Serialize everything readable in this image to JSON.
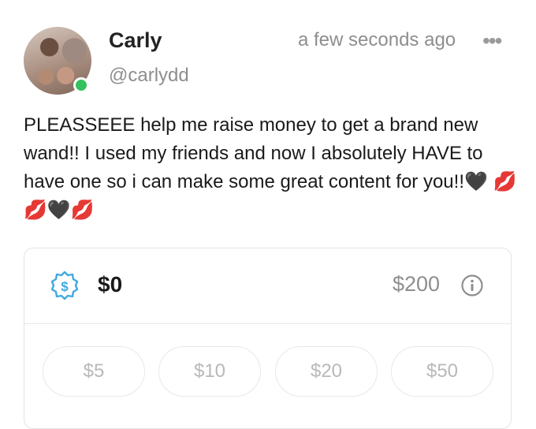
{
  "post": {
    "display_name": "Carly",
    "username": "@carlydd",
    "timestamp": "a few seconds ago",
    "more_icon": "more-horizontal-icon",
    "text": "PLEASSEEE help me raise money to get a brand new wand!! I used my friends and now I absolutely HAVE to have one so i can make some great content for you!!🖤 💋💋🖤💋"
  },
  "tip": {
    "raised": "$0",
    "goal": "$200",
    "icons": {
      "money": "dollar-badge-icon",
      "info": "info-icon"
    },
    "amounts": [
      "$5",
      "$10",
      "$20",
      "$50"
    ]
  },
  "colors": {
    "accent": "#3fa9e0",
    "online": "#35c15c",
    "muted_text": "#8e8e8e"
  }
}
